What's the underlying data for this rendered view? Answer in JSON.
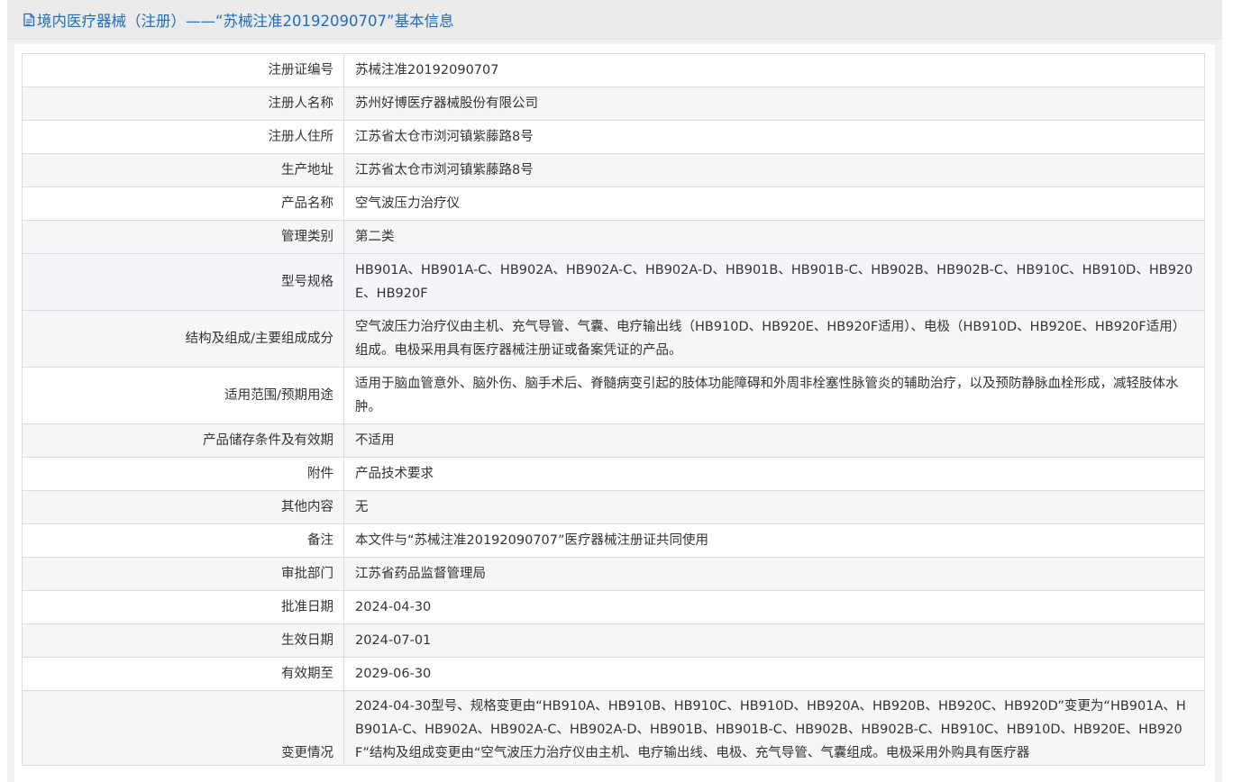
{
  "header": {
    "title": "境内医疗器械（注册）——“苏械注准20192090707”基本信息"
  },
  "rows": [
    {
      "label": "注册证编号",
      "value": "苏械注准20192090707"
    },
    {
      "label": "注册人名称",
      "value": "苏州好博医疗器械股份有限公司"
    },
    {
      "label": "注册人住所",
      "value": "江苏省太仓市浏河镇紫藤路8号"
    },
    {
      "label": "生产地址",
      "value": "江苏省太仓市浏河镇紫藤路8号"
    },
    {
      "label": "产品名称",
      "value": "空气波压力治疗仪"
    },
    {
      "label": "管理类别",
      "value": "第二类"
    },
    {
      "label": "型号规格",
      "value": "HB901A、HB901A-C、HB902A、HB902A-C、HB902A-D、HB901B、HB901B-C、HB902B、HB902B-C、HB910C、HB910D、HB920E、HB920F"
    },
    {
      "label": "结构及组成/主要组成成分",
      "value": "空气波压力治疗仪由主机、充气导管、气囊、电疗输出线（HB910D、HB920E、HB920F适用）、电极（HB910D、HB920E、HB920F适用）组成。电极采用具有医疗器械注册证或备案凭证的产品。"
    },
    {
      "label": "适用范围/预期用途",
      "value": "适用于脑血管意外、脑外伤、脑手术后、脊髓病变引起的肢体功能障碍和外周非栓塞性脉管炎的辅助治疗，以及预防静脉血栓形成，减轻肢体水肿。"
    },
    {
      "label": "产品储存条件及有效期",
      "value": "不适用"
    },
    {
      "label": "附件",
      "value": "产品技术要求"
    },
    {
      "label": "其他内容",
      "value": "无"
    },
    {
      "label": "备注",
      "value": "本文件与“苏械注准20192090707”医疗器械注册证共同使用"
    },
    {
      "label": "审批部门",
      "value": "江苏省药品监督管理局"
    },
    {
      "label": "批准日期",
      "value": "2024-04-30"
    },
    {
      "label": "生效日期",
      "value": "2024-07-01"
    },
    {
      "label": "有效期至",
      "value": "2029-06-30"
    },
    {
      "label": "变更情况",
      "value": "2024-04-30型号、规格变更由“HB910A、HB910B、HB910C、HB910D、HB920A、HB920B、HB920C、HB920D”变更为“HB901A、HB901A-C、HB902A、HB902A-C、HB902A-D、HB901B、HB901B-C、HB902B、HB902B-C、HB910C、HB910D、HB920E、HB920F”结构及组成变更由“空气波压力治疗仪由主机、电疗输出线、电极、充气导管、气囊组成。电极采用外购具有医疗器"
    }
  ],
  "colors": {
    "title": "#1e6fb8",
    "border": "#dcdcdc",
    "row_alt": "#f6f6f6",
    "row_highlight": "#f3f5f9"
  },
  "icons": {
    "header_icon": "document-icon"
  }
}
